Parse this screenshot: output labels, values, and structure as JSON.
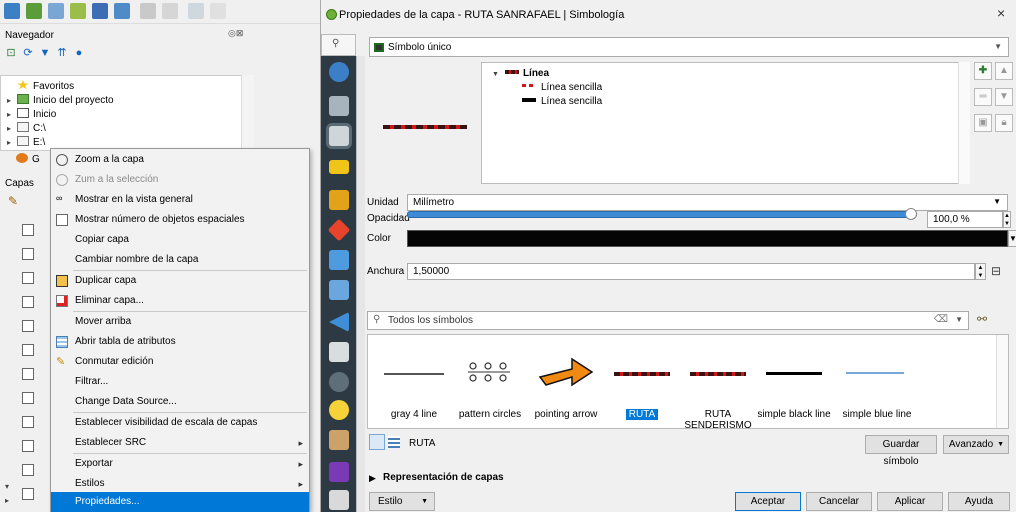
{
  "dialog": {
    "title": "Propiedades de la capa - RUTA SANRAFAEL | Simbología",
    "close": "×"
  },
  "navigator": {
    "title": "Navegador",
    "controls": "◎⊠",
    "items": [
      {
        "label": "Favoritos",
        "arrow": ""
      },
      {
        "label": "Inicio del proyecto",
        "arrow": "▸"
      },
      {
        "label": "Inicio",
        "arrow": "▸"
      },
      {
        "label": "C:\\",
        "arrow": "▸"
      },
      {
        "label": "E:\\",
        "arrow": "▸"
      },
      {
        "label": "G",
        "arrow": ""
      }
    ]
  },
  "layers_panel": {
    "title": "Capas"
  },
  "context_menu": {
    "items": [
      {
        "label": "Zoom a la capa",
        "state": "normal"
      },
      {
        "label": "Zum a la selección",
        "state": "disabled"
      },
      {
        "label": "Mostrar en la vista general",
        "state": "normal"
      },
      {
        "label": "Mostrar número de objetos espaciales",
        "state": "normal"
      },
      {
        "label": "Copiar capa",
        "state": "normal"
      },
      {
        "label": "Cambiar nombre de la capa",
        "state": "normal"
      },
      {
        "label": "Duplicar capa",
        "state": "normal"
      },
      {
        "label": "Eliminar capa...",
        "state": "normal"
      },
      {
        "label": "Mover arriba",
        "state": "normal"
      },
      {
        "label": "Abrir tabla de atributos",
        "state": "normal"
      },
      {
        "label": "Conmutar edición",
        "state": "normal"
      },
      {
        "label": "Filtrar...",
        "state": "normal"
      },
      {
        "label": "Change Data Source...",
        "state": "normal"
      },
      {
        "label": "Establecer visibilidad de escala de capas",
        "state": "normal"
      },
      {
        "label": "Establecer SRC",
        "state": "normal",
        "submenu": "▸"
      },
      {
        "label": "Exportar",
        "state": "normal",
        "submenu": "▸"
      },
      {
        "label": "Estilos",
        "state": "normal",
        "submenu": "▸"
      },
      {
        "label": "Propiedades...",
        "state": "selected"
      }
    ]
  },
  "symbology": {
    "renderer": "Símbolo único",
    "tree": {
      "root": "Línea",
      "children": [
        "Línea sencilla",
        "Línea sencilla"
      ]
    },
    "unit_label": "Unidad",
    "unit_value": "Milímetro",
    "opacity_label": "Opacidad",
    "opacity_value": "100,0 %",
    "opacity_fraction": 1.0,
    "color_label": "Color",
    "color_value": "#050505",
    "width_label": "Anchura",
    "width_value": "1,50000",
    "search_placeholder": "Todos los símbolos",
    "gallery": [
      {
        "label": "gray 4 line",
        "selected": false
      },
      {
        "label": "pattern circles",
        "selected": false
      },
      {
        "label": "pointing arrow",
        "selected": false
      },
      {
        "label": "RUTA",
        "selected": true
      },
      {
        "label": "RUTA SENDERISMO",
        "selected": false
      },
      {
        "label": "simple black line",
        "selected": false
      },
      {
        "label": "simple blue line",
        "selected": false
      }
    ],
    "library_name": "RUTA",
    "save_symbol": "Guardar símbolo",
    "advanced": "Avanzado",
    "layer_rendering": "Representación de capas"
  },
  "footer": {
    "style": "Estilo",
    "accept": "Aceptar",
    "cancel": "Cancelar",
    "apply": "Aplicar",
    "help": "Ayuda"
  },
  "colors": {
    "selection": "#0078d7",
    "route_dark": "#3a1212",
    "route_red": "#d01818",
    "sidebar": "#2d3a43"
  }
}
